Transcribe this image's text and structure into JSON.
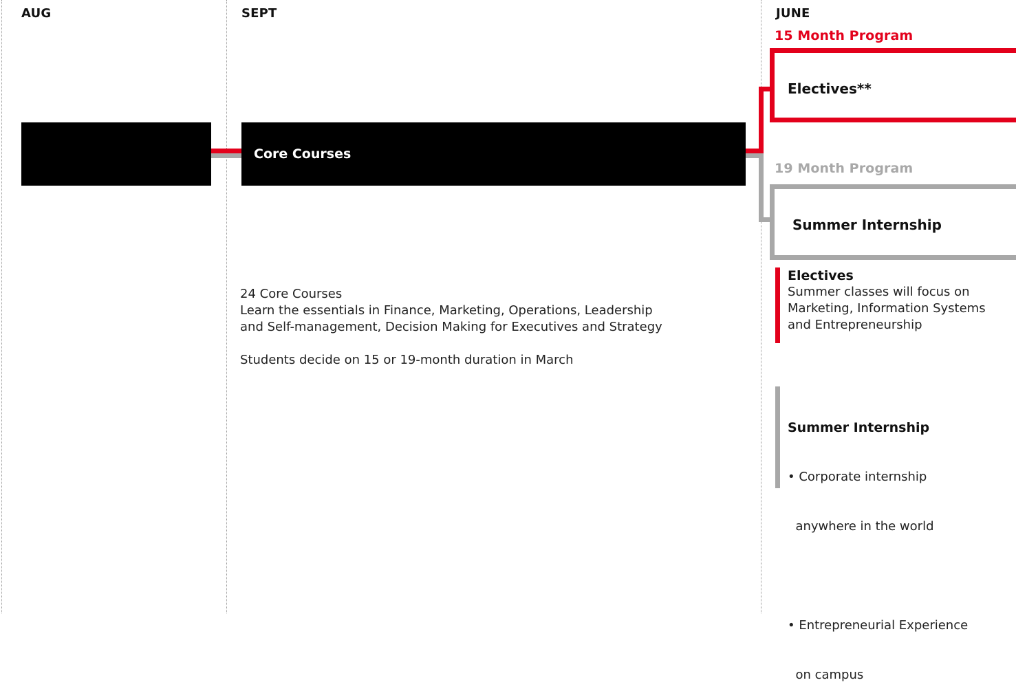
{
  "months": {
    "aug": "AUG",
    "sept": "SEPT",
    "june": "JUNE"
  },
  "program_15": {
    "label": "15 Month Program",
    "box_label": "Electives**",
    "color": "#e3001b"
  },
  "program_19": {
    "label": "19 Month Program",
    "box_label": "Summer Internship",
    "color": "#a8a8a8"
  },
  "core": {
    "box_label": "Core Courses",
    "description": [
      "24 Core Courses",
      "Learn the essentials  in Finance, Marketing, Operations, Leadership",
      "and Self-management, Decision Making for Executives and Strategy",
      "",
      "Students decide on 15 or 19-month duration in March"
    ]
  },
  "electives_info": {
    "title": "Electives",
    "lines": [
      "Summer classes will focus on",
      "Marketing, Information Systems",
      "and Entrepreneurship"
    ]
  },
  "internship_info": {
    "title": "Summer Internship",
    "lines": [
      "• Corporate internship",
      "  anywhere in the world",
      "",
      "• Entrepreneurial Experience",
      "  on campus"
    ]
  },
  "colors": {
    "accent_red": "#e3001b",
    "neutral_gray": "#a8a8a8",
    "black": "#000000"
  }
}
